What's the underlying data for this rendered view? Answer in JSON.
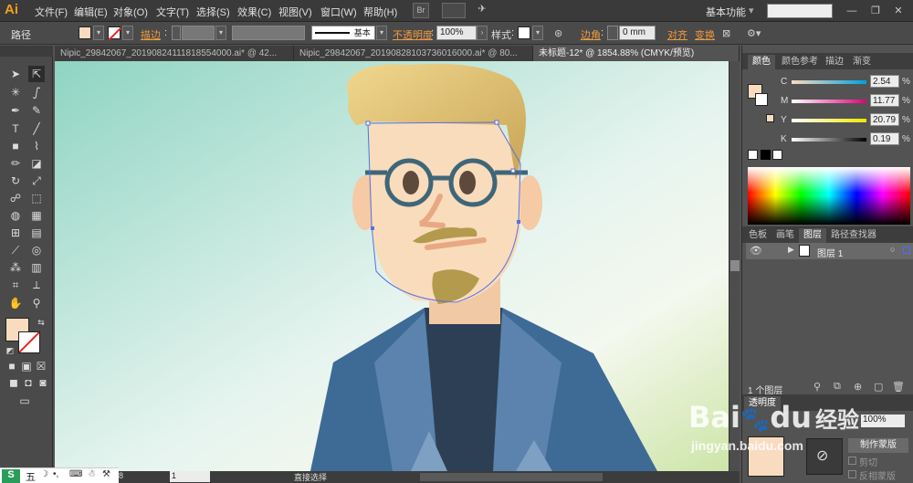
{
  "app": {
    "logo": "Ai"
  },
  "menu": [
    "文件(F)",
    "编辑(E)",
    "对象(O)",
    "文字(T)",
    "选择(S)",
    "效果(C)",
    "视图(V)",
    "窗口(W)",
    "帮助(H)"
  ],
  "menu_extra": {
    "br": "Br",
    "workspace": "基本功能"
  },
  "control": {
    "selection_type": "路径",
    "stroke_label": "描边",
    "stroke_style": "基本",
    "opacity_label": "不透明度",
    "opacity_value": "100%",
    "style_label": "样式",
    "corner_label": "边角",
    "corner_value": "0 mm",
    "align_label": "对齐",
    "transform_label": "变换",
    "fill_color": "#f9dcc0"
  },
  "tabs": [
    {
      "label": "Nipic_29842067_20190824111818554000.ai* @ 42..."
    },
    {
      "label": "Nipic_29842067_20190828103736016000.ai* @ 80..."
    },
    {
      "label": "未标题-12* @ 1854.88% (CMYK/预览)"
    }
  ],
  "color_panel": {
    "tabs": [
      "颜色",
      "颜色参考",
      "描边",
      "渐变"
    ],
    "channels": [
      {
        "label": "C",
        "value": "2.54",
        "pct": "%"
      },
      {
        "label": "M",
        "value": "11.77",
        "pct": "%"
      },
      {
        "label": "Y",
        "value": "20.79",
        "pct": "%"
      },
      {
        "label": "K",
        "value": "0.19",
        "pct": "%"
      }
    ]
  },
  "layers_panel": {
    "tabs": [
      "色板",
      "画笔",
      "图层",
      "路径查找器"
    ],
    "layer_name": "图层 1",
    "layer_count": "1 个图层"
  },
  "transparency_panel": {
    "tab": "透明度",
    "opacity": "100%",
    "make_mask": "制作蒙版",
    "clip": "剪切",
    "invert_mask": "反相蒙版"
  },
  "status": {
    "zoom": "8",
    "page": "1",
    "tool": "直接选择"
  },
  "watermark": {
    "brand": "Bai",
    "brand2": "du",
    "jing": "经验",
    "url": "jingyan.baidu.com"
  },
  "taskbar": {
    "ime": "五"
  }
}
